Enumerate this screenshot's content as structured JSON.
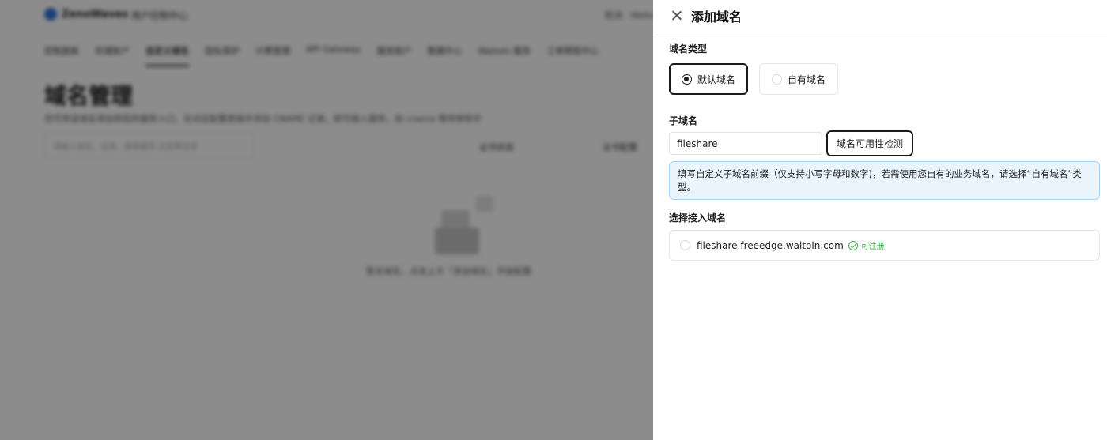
{
  "background": {
    "brand": "ZenoWaves",
    "console_label": "用户控制中心",
    "topright_text": "取消 · WaitoIn",
    "nav": [
      "控制面板",
      "存储账户",
      "自定义域名",
      "隐私保护",
      "计费管理",
      "API Gateway",
      "服务账户",
      "数据中心",
      "WaitoIn 服务",
      "工单帮助中心"
    ],
    "active_nav_index": 2,
    "title": "域名管理",
    "description": "您可将该域名添加到您的服务入口，在对应配置表格中添加 CNAME 记录，即可接入服务，如 cname 等待审核中",
    "search_placeholder": "请输入域名，支持、搜索服务 状态等信息",
    "col_status": "证书状态",
    "col_action": "证书配置",
    "empty_text": "暂无域名，点击上方「添加域名」开始配置"
  },
  "drawer": {
    "title": "添加域名",
    "domain_type_label": "域名类型",
    "options": [
      {
        "label": "默认域名",
        "selected": true
      },
      {
        "label": "自有域名",
        "selected": false
      }
    ],
    "subdomain_label": "子域名",
    "subdomain_value": "fileshare",
    "check_button": "域名可用性检测",
    "info_text": "填写自定义子域名前缀（仅支持小写字母和数字)，若需使用您自有的业务域名，请选择“自有域名”类型。",
    "select_label": "选择接入域名",
    "domain_option": "fileshare.freeedge.waitoin.com",
    "available_text": "可注册"
  },
  "colors": {
    "selected_border": "#1a1a1a",
    "info_bg": "#e9f4fd",
    "info_border": "#a9d1f2",
    "success": "#3cb043"
  }
}
